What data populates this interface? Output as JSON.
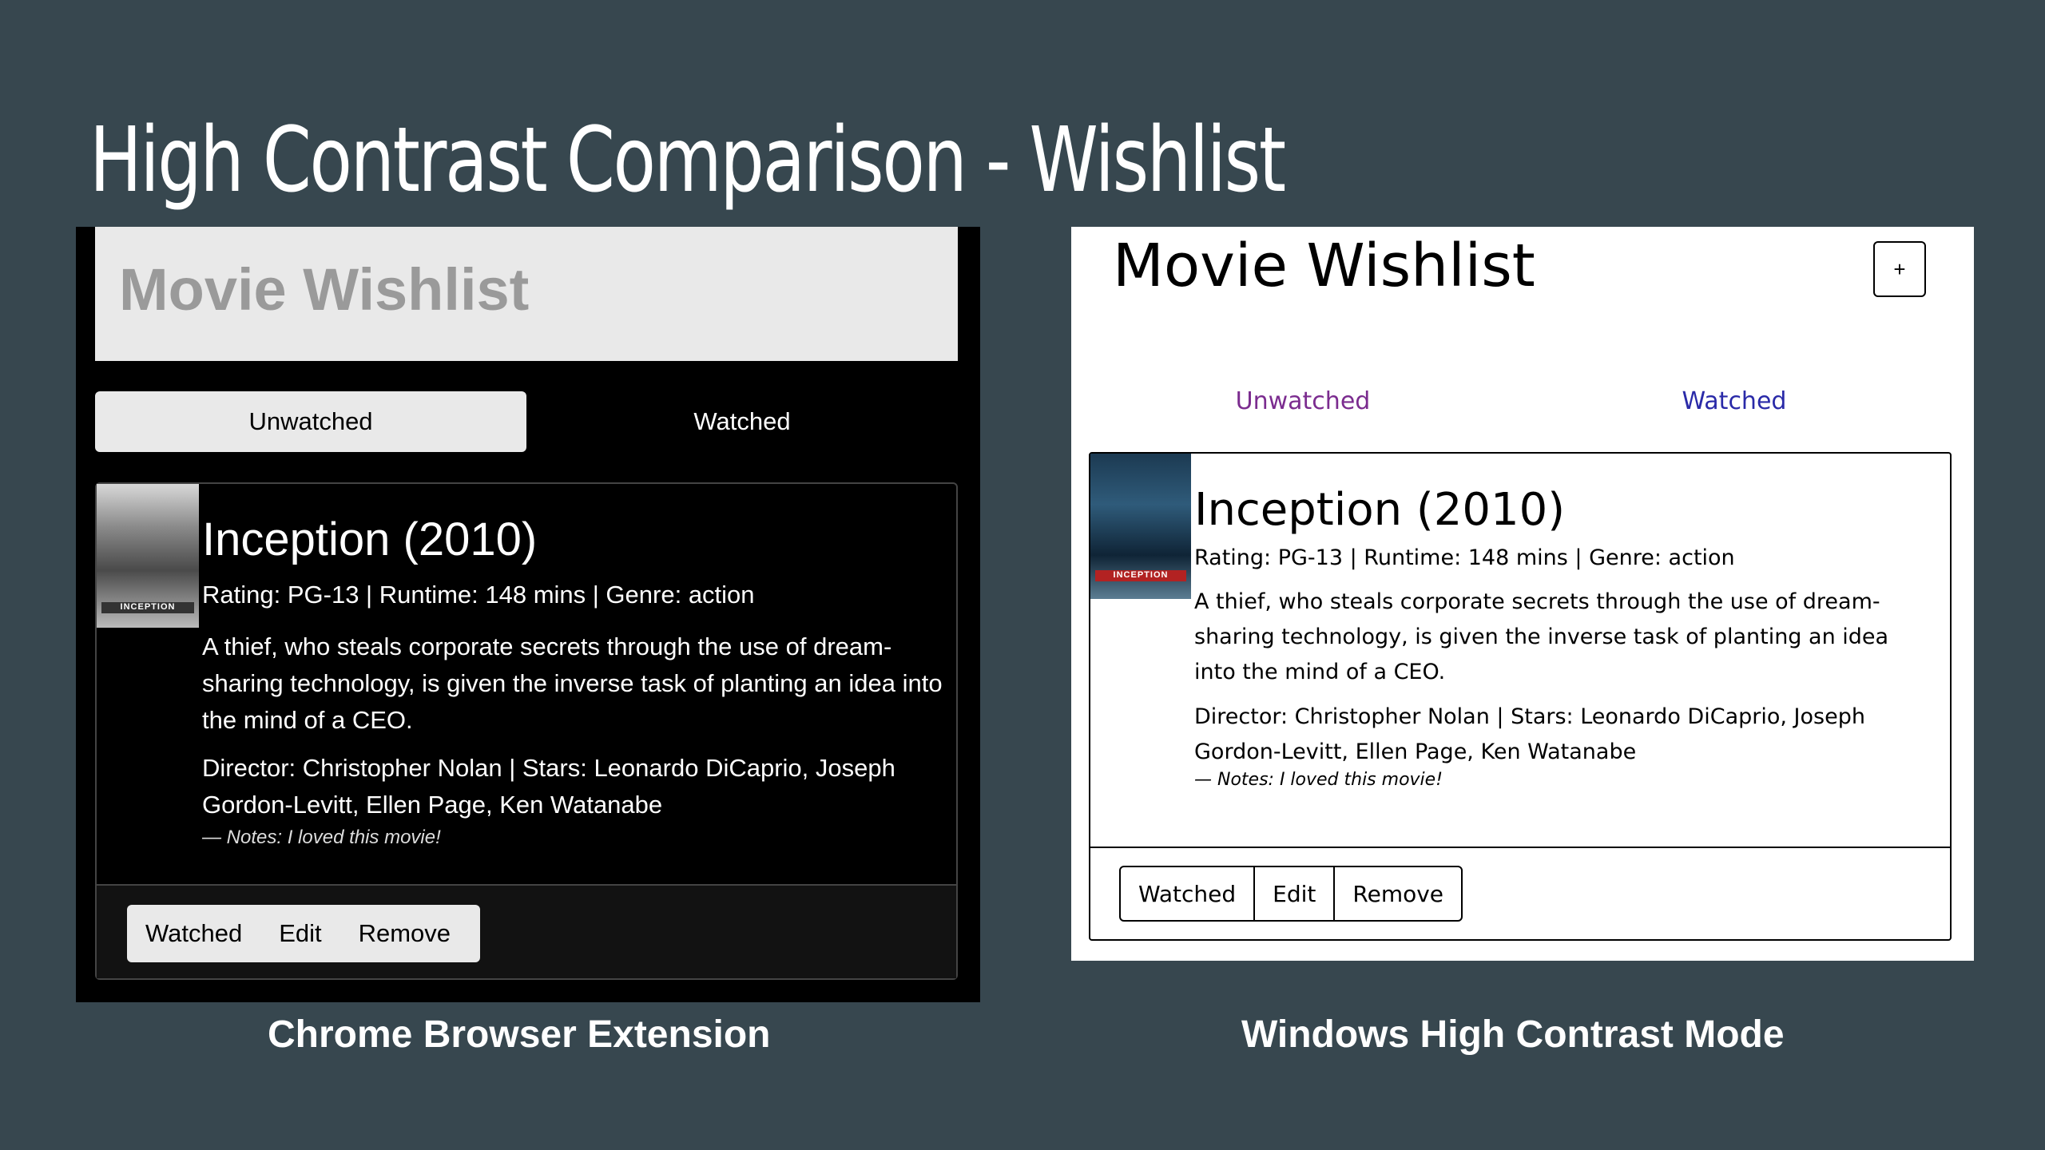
{
  "slide": {
    "title": "High Contrast Comparison - Wishlist",
    "caption_left": "Chrome Browser Extension",
    "caption_right": "Windows High Contrast Mode"
  },
  "left": {
    "app_title": "Movie Wishlist",
    "tabs": [
      {
        "label": "Unwatched",
        "active": true
      },
      {
        "label": "Watched",
        "active": false
      }
    ],
    "movie": {
      "title": "Inception (2010)",
      "meta": "Rating: PG-13 | Runtime: 148 mins | Genre: action",
      "description": "A thief, who steals corporate secrets through the use of dream-sharing technology, is given the inverse task of planting an idea into the mind of a CEO.",
      "cast": "Director: Christopher Nolan | Stars: Leonardo DiCaprio, Joseph Gordon-Levitt, Ellen Page, Ken Watanabe",
      "notes": "— Notes: I loved this movie!",
      "poster_text": "INCEPTION"
    },
    "buttons": {
      "watched": "Watched",
      "edit": "Edit",
      "remove": "Remove"
    }
  },
  "right": {
    "app_title": "Movie Wishlist",
    "add_button": "+",
    "tabs": [
      {
        "label": "Unwatched"
      },
      {
        "label": "Watched"
      }
    ],
    "movie": {
      "title": "Inception (2010)",
      "meta": "Rating: PG-13 | Runtime: 148 mins | Genre: action",
      "description": "A thief, who steals corporate secrets through the use of dream-sharing technology, is given the inverse task of planting an idea into the mind of a CEO.",
      "cast": "Director: Christopher Nolan | Stars: Leonardo DiCaprio, Joseph Gordon-Levitt, Ellen Page, Ken Watanabe",
      "notes": "— Notes: I loved this movie!",
      "poster_text": "INCEPTION"
    },
    "buttons": {
      "watched": "Watched",
      "edit": "Edit",
      "remove": "Remove"
    }
  },
  "colors": {
    "slide_bg": "#37474f",
    "left_panel_bg": "#000000",
    "right_panel_bg": "#ffffff",
    "visited_link": "#7b2c8f",
    "link": "#2a2aa8"
  }
}
